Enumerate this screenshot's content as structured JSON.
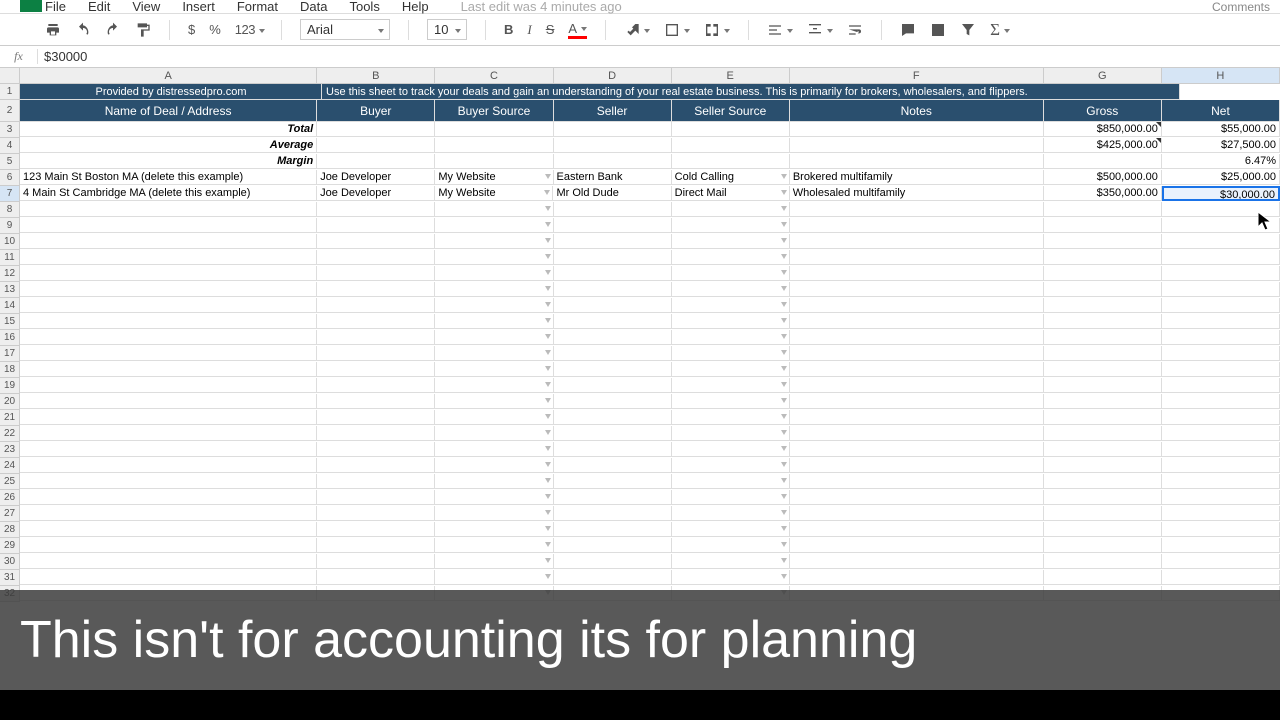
{
  "menu": {
    "file": "File",
    "edit": "Edit",
    "view": "View",
    "insert": "Insert",
    "format": "Format",
    "data": "Data",
    "tools": "Tools",
    "help": "Help",
    "last_edit": "Last edit was 4 minutes ago",
    "comments": "Comments"
  },
  "toolbar": {
    "font": "Arial",
    "size": "10",
    "fmt123": "123",
    "dollar": "$",
    "percent": "%"
  },
  "formula": {
    "label": "fx",
    "value": "$30000"
  },
  "columns": [
    "A",
    "B",
    "C",
    "D",
    "E",
    "F",
    "G",
    "H"
  ],
  "row1": {
    "a": "Provided by distressedpro.com",
    "rest": "Use this sheet to track your deals and gain an understanding of your real estate business. This is primarily for brokers, wholesalers, and flippers."
  },
  "headers": {
    "a": "Name of Deal / Address",
    "b": "Buyer",
    "c": "Buyer Source",
    "d": "Seller",
    "e": "Seller Source",
    "f": "Notes",
    "g": "Gross",
    "h": "Net"
  },
  "summary": {
    "total": {
      "label": "Total",
      "g": "$850,000.00",
      "h": "$55,000.00"
    },
    "average": {
      "label": "Average",
      "g": "$425,000.00",
      "h": "$27,500.00"
    },
    "margin": {
      "label": "Margin",
      "h": "6.47%"
    }
  },
  "data_rows": [
    {
      "a": "123 Main St Boston MA (delete this example)",
      "b": "Joe Developer",
      "c": "My Website",
      "d": "Eastern Bank",
      "e": "Cold Calling",
      "f": "Brokered multifamily",
      "g": "$500,000.00",
      "h": "$25,000.00"
    },
    {
      "a": "4 Main St Cambridge MA (delete this example)",
      "b": "Joe Developer",
      "c": "My Website",
      "d": "Mr Old Dude",
      "e": "Direct Mail",
      "f": "Wholesaled multifamily",
      "g": "$350,000.00",
      "h": "$30,000.00"
    }
  ],
  "selected_cell": {
    "row": 7,
    "col": "H"
  },
  "overlay_text": "This isn't for accounting its for planning",
  "chart_data": {
    "type": "table",
    "title": "Deal Tracker",
    "columns": [
      "Name of Deal / Address",
      "Buyer",
      "Buyer Source",
      "Seller",
      "Seller Source",
      "Notes",
      "Gross",
      "Net"
    ],
    "rows": [
      [
        "123 Main St Boston MA (delete this example)",
        "Joe Developer",
        "My Website",
        "Eastern Bank",
        "Cold Calling",
        "Brokered multifamily",
        500000.0,
        25000.0
      ],
      [
        "4 Main St Cambridge MA (delete this example)",
        "Joe Developer",
        "My Website",
        "Mr Old Dude",
        "Direct Mail",
        "Wholesaled multifamily",
        350000.0,
        30000.0
      ]
    ],
    "summary": {
      "Total": {
        "Gross": 850000.0,
        "Net": 55000.0
      },
      "Average": {
        "Gross": 425000.0,
        "Net": 27500.0
      },
      "Margin": {
        "Net": 0.0647
      }
    }
  }
}
